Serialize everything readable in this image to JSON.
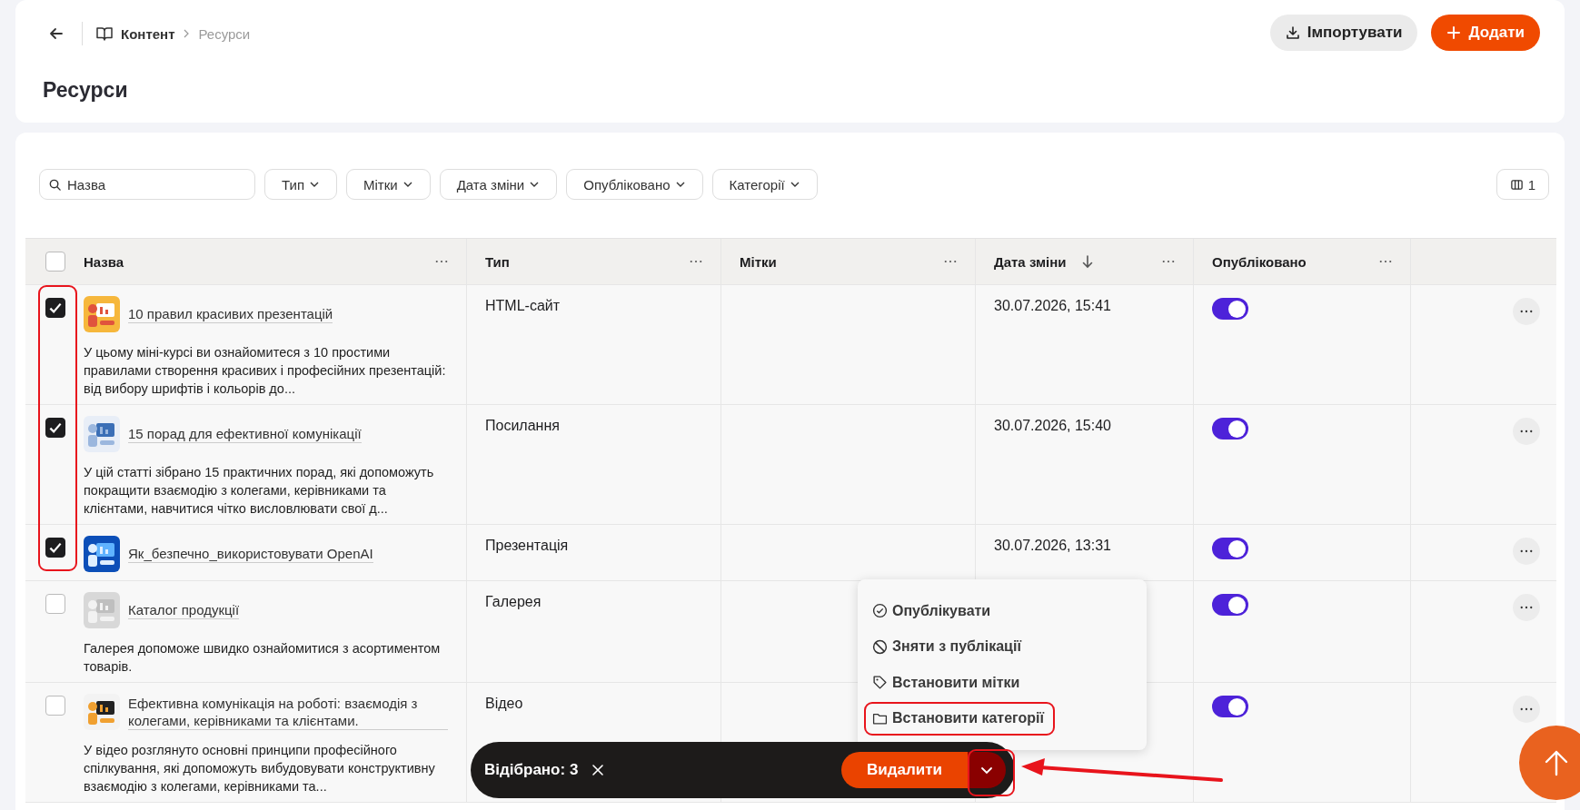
{
  "breadcrumb": [
    {
      "label": "Контент",
      "current": false
    },
    {
      "label": "Ресурси",
      "current": true
    }
  ],
  "page_title": "Ресурси",
  "header_buttons": [
    {
      "label": "Імпортувати",
      "kind": "secondary"
    },
    {
      "label": "Додати",
      "kind": "primary"
    }
  ],
  "search": {
    "placeholder": "Назва"
  },
  "filters": [
    "Тип",
    "Мітки",
    "Дата зміни",
    "Опубліковано",
    "Категорії"
  ],
  "columns_button": "1",
  "table": {
    "select_all_checked": false,
    "checkbox_highlight": true,
    "columns": [
      {
        "label": "Назва"
      },
      {
        "label": "Тип"
      },
      {
        "label": "Мітки"
      },
      {
        "label": "Дата зміни",
        "sorted_desc": true
      },
      {
        "label": "Опубліковано"
      }
    ],
    "rows": [
      {
        "checked": true,
        "title": "10 правил красивих презентацій",
        "description": "У цьому міні-курсі ви ознайомитеся з 10 простими правилами створення красивих і професійних презентацій: від вибору шрифтів і кольорів до...",
        "type": "HTML-сайт",
        "modified": "30.07.2026, 15:41",
        "published": true
      },
      {
        "checked": true,
        "title": "15 порад для ефективної комунікації",
        "description": "У цій статті зібрано 15 практичних порад, які допоможуть покращити взаємодію з колегами, керівниками та клієнтами, навчитися чітко висловлювати свої д...",
        "type": "Посилання",
        "modified": "30.07.2026, 15:40",
        "published": true
      },
      {
        "checked": true,
        "title": "Як_безпечно_використовувати OpenAI",
        "type": "Презентація",
        "modified": "30.07.2026, 13:31",
        "published": true
      },
      {
        "checked": false,
        "title": "Каталог продукції",
        "description": "Галерея допоможе швидко ознайомитися з асортиментом товарів.",
        "type": "Галерея",
        "published": true
      },
      {
        "checked": false,
        "title": "Ефективна комунікація на роботі: взаємодія з колегами, керівниками та клієнтами.",
        "description": "У відео розглянуто основні принципи професійного спілкування, які допоможуть вибудовувати конструктивну взаємодію з колегами, керівниками та...",
        "type": "Відео",
        "published": true
      }
    ]
  },
  "menu": {
    "items": [
      {
        "kind": "publish",
        "label": "Опублікувати",
        "highlighted": false
      },
      {
        "kind": "unpublish",
        "label": "Зняти з публікації",
        "highlighted": false
      },
      {
        "kind": "tags",
        "label": "Встановити мітки",
        "highlighted": false
      },
      {
        "kind": "categories",
        "label": "Встановити категорії",
        "highlighted": true
      }
    ]
  },
  "selection_bar": {
    "label": "Відібрано: 3",
    "delete_button": "Видалити",
    "toggle_highlighted": true,
    "arrow": true
  }
}
